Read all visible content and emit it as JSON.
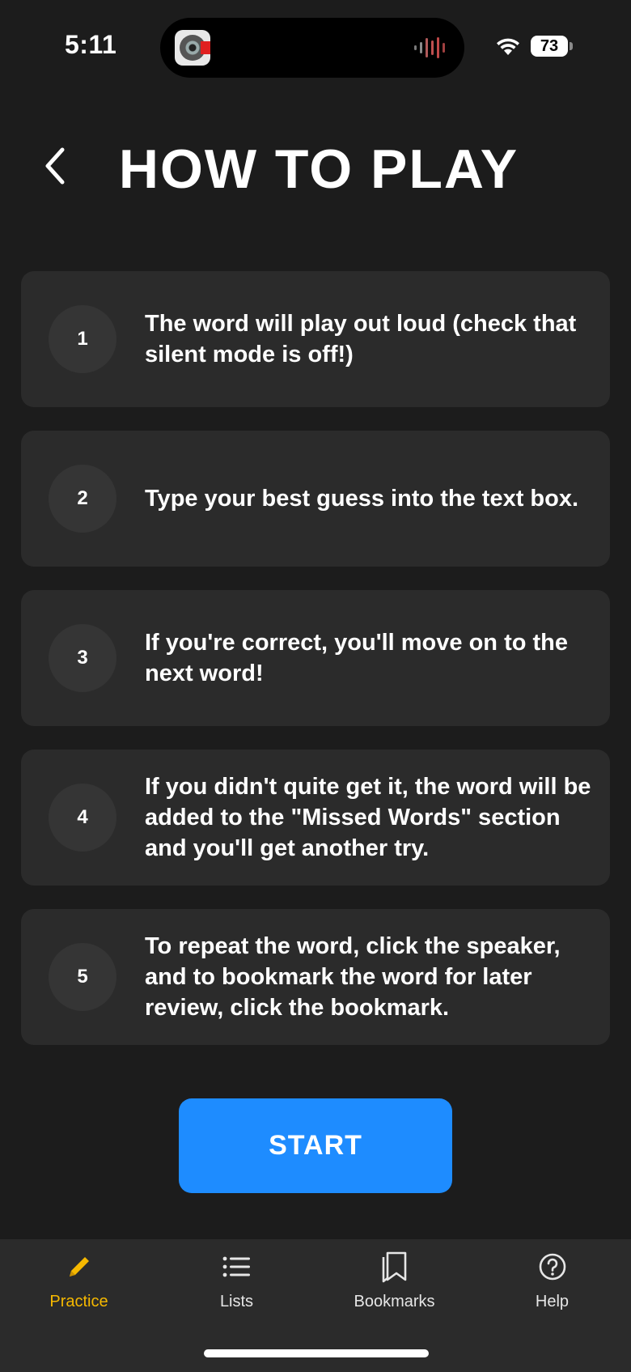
{
  "status_bar": {
    "time": "5:11",
    "battery": "73"
  },
  "header": {
    "title": "HOW TO PLAY"
  },
  "steps": [
    {
      "number": "1",
      "text": "The word will play out loud (check that silent mode is off!)"
    },
    {
      "number": "2",
      "text": "Type your best guess into the text box."
    },
    {
      "number": "3",
      "text": "If you're correct, you'll move on to the next word!"
    },
    {
      "number": "4",
      "text": "If you didn't quite get it, the word will be added to the \"Missed Words\" section and you'll get another try."
    },
    {
      "number": "5",
      "text": "To repeat the word, click the speaker, and to bookmark the word for later review, click the bookmark."
    }
  ],
  "start_button": {
    "label": "START"
  },
  "tab_bar": {
    "tabs": [
      {
        "label": "Practice",
        "icon": "pencil-icon",
        "active": true
      },
      {
        "label": "Lists",
        "icon": "list-icon",
        "active": false
      },
      {
        "label": "Bookmarks",
        "icon": "bookmark-icon",
        "active": false
      },
      {
        "label": "Help",
        "icon": "help-icon",
        "active": false
      }
    ]
  },
  "colors": {
    "background": "#1c1c1c",
    "card": "#2b2b2b",
    "accent": "#1e8cff",
    "active_tab": "#f5b800"
  }
}
